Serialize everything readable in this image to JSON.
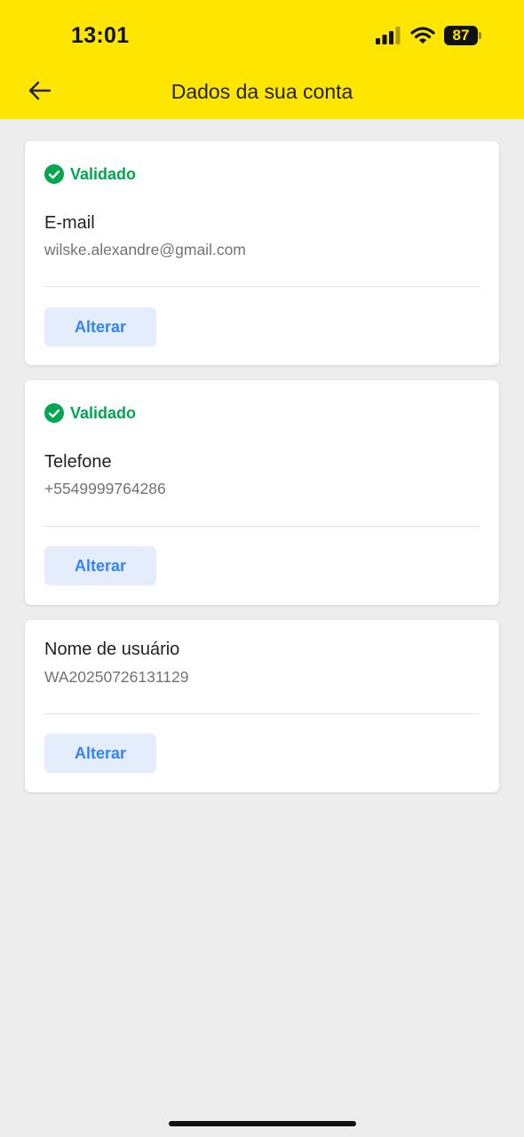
{
  "status_bar": {
    "time": "13:01",
    "battery": "87",
    "icons": [
      "signal-icon",
      "wifi-icon",
      "battery-icon"
    ]
  },
  "header": {
    "title": "Dados da sua conta",
    "back_icon": "arrow-left-icon"
  },
  "cards": [
    {
      "badge": "Validado",
      "label": "E-mail",
      "value": "wilske.alexandre@gmail.com",
      "button": "Alterar"
    },
    {
      "badge": "Validado",
      "label": "Telefone",
      "value": "+5549999764286",
      "button": "Alterar"
    },
    {
      "label": "Nome de usuário",
      "value": "WA20250726131129",
      "button": "Alterar"
    }
  ],
  "colors": {
    "header_bg": "#ffe600",
    "page_bg": "#ededed",
    "validated_green": "#00a650",
    "button_text_blue": "#3483fa",
    "button_bg": "#e3edfb"
  }
}
